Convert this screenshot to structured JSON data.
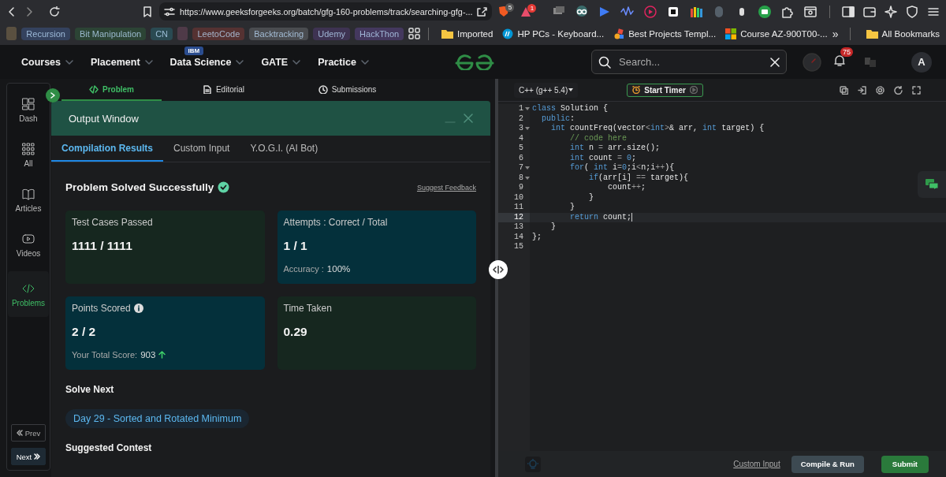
{
  "browser": {
    "url": "https://www.geeksforgeeks.org/batch/gfg-160-problems/track/searching-gfg-...",
    "shield_badge": "5",
    "alert_badge": "1",
    "bookmarks": [
      {
        "kind": "swatch",
        "color": "#5a5040"
      },
      {
        "kind": "tag",
        "label": "Recursion",
        "color": "#34425e"
      },
      {
        "kind": "tag",
        "label": "Bit Manipulation",
        "color": "#2c4435"
      },
      {
        "kind": "tag",
        "label": "CN",
        "color": "#2a4a52"
      },
      {
        "kind": "swatch",
        "color": "#4f3a48"
      },
      {
        "kind": "tag",
        "label": "LeetoCode",
        "color": "#553232"
      },
      {
        "kind": "tag",
        "label": "Backtracking",
        "color": "#4a4c50"
      },
      {
        "kind": "tag",
        "label": "Udemy",
        "color": "#3e3352"
      },
      {
        "kind": "tag",
        "label": "HackThon",
        "color": "#44385e"
      },
      {
        "kind": "apps"
      },
      {
        "kind": "folder",
        "label": "Imported"
      },
      {
        "kind": "link",
        "label": "HP PCs - Keyboard..."
      },
      {
        "kind": "link",
        "label": "Best Projects Templ..."
      },
      {
        "kind": "link",
        "label": "Course AZ-900T00-..."
      }
    ],
    "overflow": "»",
    "all_bookmarks": "All Bookmarks"
  },
  "site": {
    "nav": [
      {
        "label": "Courses"
      },
      {
        "label": "Placement"
      },
      {
        "label": "Data Science",
        "badge": "IBM"
      },
      {
        "label": "GATE"
      },
      {
        "label": "Practice"
      }
    ],
    "search": {
      "placeholder": "Search..."
    },
    "notifications": "75",
    "avatar": "A"
  },
  "rail": {
    "items": [
      {
        "label": "Dash",
        "selected": false
      },
      {
        "label": "All",
        "selected": false
      },
      {
        "label": "Articles",
        "selected": false
      },
      {
        "label": "Videos",
        "selected": false
      },
      {
        "label": "Problems",
        "selected": true
      }
    ],
    "prev": "Prev",
    "next": "Next"
  },
  "problem_tabs": [
    {
      "label": "Problem",
      "selected": true
    },
    {
      "label": "Editorial",
      "selected": false
    },
    {
      "label": "Submissions",
      "selected": false
    }
  ],
  "output": {
    "title": "Output Window",
    "tabs": [
      {
        "label": "Compilation Results",
        "selected": true
      },
      {
        "label": "Custom Input",
        "selected": false
      },
      {
        "label": "Y.O.G.I. (AI Bot)",
        "selected": false
      }
    ],
    "heading": "Problem Solved Successfully",
    "feedback": "Suggest Feedback",
    "cards": [
      {
        "title": "Test Cases Passed",
        "value": "1111 / 1111",
        "color": "#16271f",
        "info": false
      },
      {
        "title": "Attempts : Correct / Total",
        "value": "1 / 1",
        "color": "#04303b",
        "info": false,
        "extra_label": "Accuracy :",
        "extra_value": "100%",
        "trend_up": false
      },
      {
        "title": "Points Scored",
        "value": "2 / 2",
        "color": "#04303b",
        "info": true,
        "extra_label": "Your Total Score:",
        "extra_value": "903",
        "trend_up": true
      },
      {
        "title": "Time Taken",
        "value": "0.29",
        "color": "#16271f",
        "info": false
      }
    ],
    "solve_next": "Solve Next",
    "next_problem": "Day 29 - Sorted and Rotated Minimum",
    "contest": "Suggested Contest"
  },
  "editor": {
    "language": "C++ (g++ 5.4)",
    "timer": "Start Timer",
    "lines": [
      {
        "number": "1",
        "foldable": true,
        "current": false,
        "tokens": [
          {
            "kind": "kw",
            "text": "class"
          },
          {
            "kind": "plain",
            "text": " Solution {"
          }
        ]
      },
      {
        "number": "2",
        "foldable": false,
        "current": false,
        "tokens": [
          {
            "kind": "kw",
            "text": "  public"
          },
          {
            "kind": "plain",
            "text": ":"
          }
        ]
      },
      {
        "number": "3",
        "foldable": true,
        "current": false,
        "tokens": [
          {
            "kind": "kw",
            "text": "    int"
          },
          {
            "kind": "plain",
            "text": " countFreq(vector"
          },
          {
            "kind": "op",
            "text": "<"
          },
          {
            "kind": "kw",
            "text": "int"
          },
          {
            "kind": "op",
            "text": ">"
          },
          {
            "kind": "plain",
            "text": "& arr, "
          },
          {
            "kind": "kw",
            "text": "int"
          },
          {
            "kind": "plain",
            "text": " target) {"
          }
        ]
      },
      {
        "number": "4",
        "foldable": false,
        "current": false,
        "tokens": [
          {
            "kind": "comment",
            "text": "        // code here"
          }
        ]
      },
      {
        "number": "5",
        "foldable": false,
        "current": false,
        "tokens": [
          {
            "kind": "kw",
            "text": "        int"
          },
          {
            "kind": "plain",
            "text": " n "
          },
          {
            "kind": "op",
            "text": "="
          },
          {
            "kind": "plain",
            "text": " arr.size();"
          }
        ]
      },
      {
        "number": "6",
        "foldable": false,
        "current": false,
        "tokens": [
          {
            "kind": "kw",
            "text": "        int"
          },
          {
            "kind": "plain",
            "text": " count "
          },
          {
            "kind": "op",
            "text": "="
          },
          {
            "kind": "num",
            "text": " 0"
          },
          {
            "kind": "plain",
            "text": ";"
          }
        ]
      },
      {
        "number": "7",
        "foldable": true,
        "current": false,
        "tokens": [
          {
            "kind": "kw",
            "text": "        for"
          },
          {
            "kind": "plain",
            "text": "( "
          },
          {
            "kind": "kw",
            "text": "int"
          },
          {
            "kind": "plain",
            "text": " i"
          },
          {
            "kind": "op",
            "text": "="
          },
          {
            "kind": "num",
            "text": "0"
          },
          {
            "kind": "plain",
            "text": ";i"
          },
          {
            "kind": "op",
            "text": "<"
          },
          {
            "kind": "plain",
            "text": "n;i"
          },
          {
            "kind": "op",
            "text": "++"
          },
          {
            "kind": "plain",
            "text": "){"
          }
        ]
      },
      {
        "number": "8",
        "foldable": true,
        "current": false,
        "tokens": [
          {
            "kind": "kw",
            "text": "            if"
          },
          {
            "kind": "plain",
            "text": "(arr[i] "
          },
          {
            "kind": "op",
            "text": "=="
          },
          {
            "kind": "plain",
            "text": " target){"
          }
        ]
      },
      {
        "number": "9",
        "foldable": false,
        "current": false,
        "tokens": [
          {
            "kind": "plain",
            "text": "                count"
          },
          {
            "kind": "op",
            "text": "++"
          },
          {
            "kind": "plain",
            "text": ";"
          }
        ]
      },
      {
        "number": "10",
        "foldable": false,
        "current": false,
        "tokens": [
          {
            "kind": "plain",
            "text": "            }"
          }
        ]
      },
      {
        "number": "11",
        "foldable": false,
        "current": false,
        "tokens": [
          {
            "kind": "plain",
            "text": "        }"
          }
        ]
      },
      {
        "number": "12",
        "foldable": false,
        "current": true,
        "tokens": [
          {
            "kind": "kw",
            "text": "        return"
          },
          {
            "kind": "plain",
            "text": " count;"
          }
        ]
      },
      {
        "number": "13",
        "foldable": false,
        "current": false,
        "tokens": [
          {
            "kind": "plain",
            "text": "    }"
          }
        ]
      },
      {
        "number": "14",
        "foldable": false,
        "current": false,
        "tokens": [
          {
            "kind": "plain",
            "text": "};"
          }
        ]
      },
      {
        "number": "15",
        "foldable": false,
        "current": false
      }
    ],
    "custom_input": "Custom Input",
    "compile": "Compile & Run",
    "submit": "Submit"
  }
}
